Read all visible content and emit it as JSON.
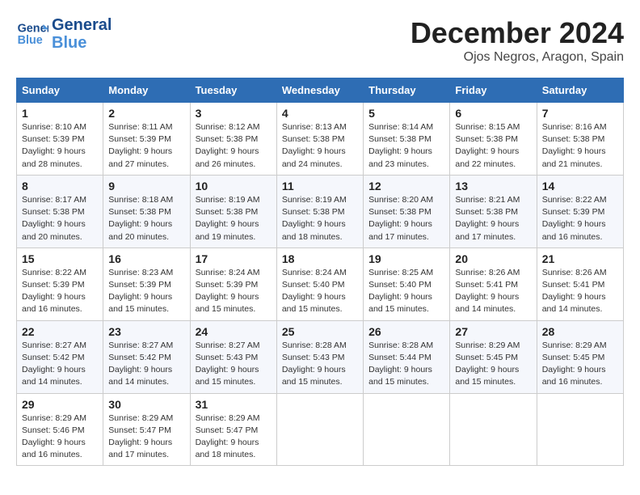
{
  "logo": {
    "line1": "General",
    "line2": "Blue"
  },
  "title": "December 2024",
  "subtitle": "Ojos Negros, Aragon, Spain",
  "headers": [
    "Sunday",
    "Monday",
    "Tuesday",
    "Wednesday",
    "Thursday",
    "Friday",
    "Saturday"
  ],
  "weeks": [
    [
      {
        "day": "1",
        "info": "Sunrise: 8:10 AM\nSunset: 5:39 PM\nDaylight: 9 hours and 28 minutes."
      },
      {
        "day": "2",
        "info": "Sunrise: 8:11 AM\nSunset: 5:39 PM\nDaylight: 9 hours and 27 minutes."
      },
      {
        "day": "3",
        "info": "Sunrise: 8:12 AM\nSunset: 5:38 PM\nDaylight: 9 hours and 26 minutes."
      },
      {
        "day": "4",
        "info": "Sunrise: 8:13 AM\nSunset: 5:38 PM\nDaylight: 9 hours and 24 minutes."
      },
      {
        "day": "5",
        "info": "Sunrise: 8:14 AM\nSunset: 5:38 PM\nDaylight: 9 hours and 23 minutes."
      },
      {
        "day": "6",
        "info": "Sunrise: 8:15 AM\nSunset: 5:38 PM\nDaylight: 9 hours and 22 minutes."
      },
      {
        "day": "7",
        "info": "Sunrise: 8:16 AM\nSunset: 5:38 PM\nDaylight: 9 hours and 21 minutes."
      }
    ],
    [
      {
        "day": "8",
        "info": "Sunrise: 8:17 AM\nSunset: 5:38 PM\nDaylight: 9 hours and 20 minutes."
      },
      {
        "day": "9",
        "info": "Sunrise: 8:18 AM\nSunset: 5:38 PM\nDaylight: 9 hours and 20 minutes."
      },
      {
        "day": "10",
        "info": "Sunrise: 8:19 AM\nSunset: 5:38 PM\nDaylight: 9 hours and 19 minutes."
      },
      {
        "day": "11",
        "info": "Sunrise: 8:19 AM\nSunset: 5:38 PM\nDaylight: 9 hours and 18 minutes."
      },
      {
        "day": "12",
        "info": "Sunrise: 8:20 AM\nSunset: 5:38 PM\nDaylight: 9 hours and 17 minutes."
      },
      {
        "day": "13",
        "info": "Sunrise: 8:21 AM\nSunset: 5:38 PM\nDaylight: 9 hours and 17 minutes."
      },
      {
        "day": "14",
        "info": "Sunrise: 8:22 AM\nSunset: 5:39 PM\nDaylight: 9 hours and 16 minutes."
      }
    ],
    [
      {
        "day": "15",
        "info": "Sunrise: 8:22 AM\nSunset: 5:39 PM\nDaylight: 9 hours and 16 minutes."
      },
      {
        "day": "16",
        "info": "Sunrise: 8:23 AM\nSunset: 5:39 PM\nDaylight: 9 hours and 15 minutes."
      },
      {
        "day": "17",
        "info": "Sunrise: 8:24 AM\nSunset: 5:39 PM\nDaylight: 9 hours and 15 minutes."
      },
      {
        "day": "18",
        "info": "Sunrise: 8:24 AM\nSunset: 5:40 PM\nDaylight: 9 hours and 15 minutes."
      },
      {
        "day": "19",
        "info": "Sunrise: 8:25 AM\nSunset: 5:40 PM\nDaylight: 9 hours and 15 minutes."
      },
      {
        "day": "20",
        "info": "Sunrise: 8:26 AM\nSunset: 5:41 PM\nDaylight: 9 hours and 14 minutes."
      },
      {
        "day": "21",
        "info": "Sunrise: 8:26 AM\nSunset: 5:41 PM\nDaylight: 9 hours and 14 minutes."
      }
    ],
    [
      {
        "day": "22",
        "info": "Sunrise: 8:27 AM\nSunset: 5:42 PM\nDaylight: 9 hours and 14 minutes."
      },
      {
        "day": "23",
        "info": "Sunrise: 8:27 AM\nSunset: 5:42 PM\nDaylight: 9 hours and 14 minutes."
      },
      {
        "day": "24",
        "info": "Sunrise: 8:27 AM\nSunset: 5:43 PM\nDaylight: 9 hours and 15 minutes."
      },
      {
        "day": "25",
        "info": "Sunrise: 8:28 AM\nSunset: 5:43 PM\nDaylight: 9 hours and 15 minutes."
      },
      {
        "day": "26",
        "info": "Sunrise: 8:28 AM\nSunset: 5:44 PM\nDaylight: 9 hours and 15 minutes."
      },
      {
        "day": "27",
        "info": "Sunrise: 8:29 AM\nSunset: 5:45 PM\nDaylight: 9 hours and 15 minutes."
      },
      {
        "day": "28",
        "info": "Sunrise: 8:29 AM\nSunset: 5:45 PM\nDaylight: 9 hours and 16 minutes."
      }
    ],
    [
      {
        "day": "29",
        "info": "Sunrise: 8:29 AM\nSunset: 5:46 PM\nDaylight: 9 hours and 16 minutes."
      },
      {
        "day": "30",
        "info": "Sunrise: 8:29 AM\nSunset: 5:47 PM\nDaylight: 9 hours and 17 minutes."
      },
      {
        "day": "31",
        "info": "Sunrise: 8:29 AM\nSunset: 5:47 PM\nDaylight: 9 hours and 18 minutes."
      },
      {
        "day": "",
        "info": ""
      },
      {
        "day": "",
        "info": ""
      },
      {
        "day": "",
        "info": ""
      },
      {
        "day": "",
        "info": ""
      }
    ]
  ]
}
